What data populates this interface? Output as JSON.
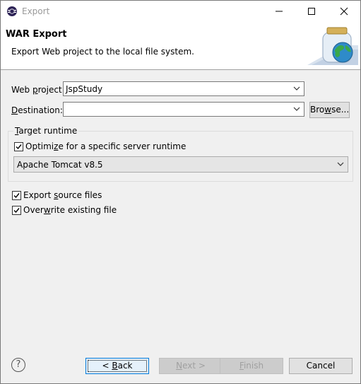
{
  "window": {
    "title": "Export"
  },
  "banner": {
    "title": "WAR Export",
    "description": "Export Web project to the local file system."
  },
  "form": {
    "web_project": {
      "label_pre": "Web ",
      "label_mn": "p",
      "label_post": "roject:",
      "value": "JspStudy"
    },
    "destination": {
      "label_mn": "D",
      "label_post": "estination:",
      "value": "",
      "browse_pre": "Bro",
      "browse_mn": "w",
      "browse_post": "se..."
    },
    "target_runtime": {
      "group_mn": "T",
      "group_post": "arget runtime",
      "optimize_pre": "Optimi",
      "optimize_mn": "z",
      "optimize_post": "e for a specific server runtime",
      "optimize_checked": true,
      "runtime_value": "Apache Tomcat v8.5"
    },
    "export_source": {
      "pre": "Export ",
      "mn": "s",
      "post": "ource files",
      "checked": true
    },
    "overwrite": {
      "pre": "Over",
      "mn": "w",
      "post": "rite existing file",
      "checked": true
    }
  },
  "buttons": {
    "back_pre": "< ",
    "back_mn": "B",
    "back_post": "ack",
    "next_mn": "N",
    "next_post": "ext >",
    "finish_mn": "F",
    "finish_post": "inish",
    "cancel": "Cancel"
  },
  "icons": {
    "app": "eclipse-icon",
    "minimize": "minimize-icon",
    "maximize": "maximize-icon",
    "close": "close-icon",
    "banner": "jar-globe-icon",
    "help": "help-icon",
    "dropdown": "chevron-down-icon",
    "check": "checkmark-icon"
  }
}
